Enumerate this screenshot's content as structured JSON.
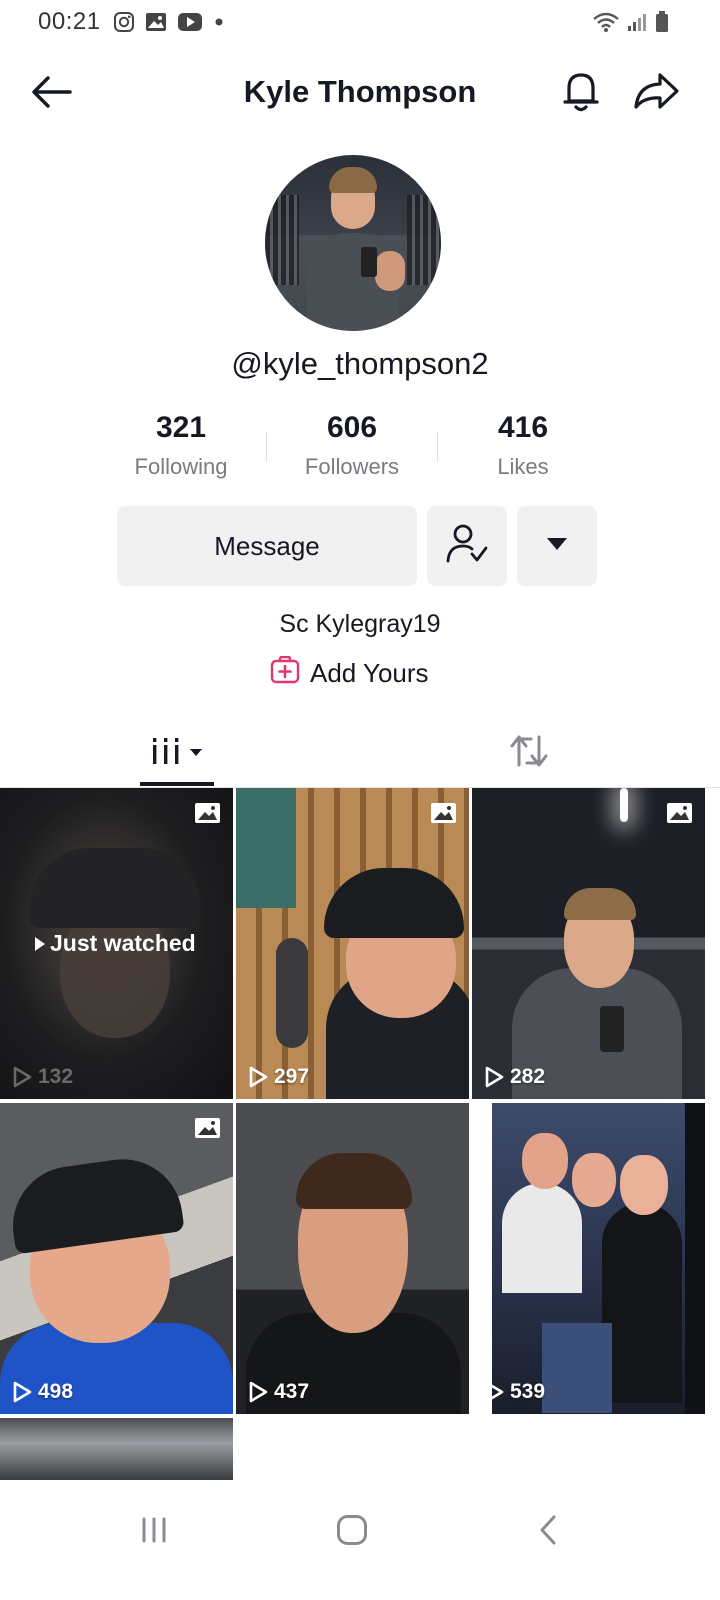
{
  "status_bar": {
    "time": "00:21",
    "left_icons": [
      "instagram-icon",
      "gallery-icon",
      "youtube-icon",
      "dot-icon"
    ],
    "right_icons": [
      "wifi-icon",
      "signal-icon",
      "battery-icon"
    ]
  },
  "header": {
    "title": "Kyle Thompson",
    "back_icon": "arrow-left-icon",
    "bell_icon": "bell-icon",
    "share_icon": "share-arrow-icon"
  },
  "profile": {
    "username": "@kyle_thompson2",
    "stats": [
      {
        "value": "321",
        "label": "Following"
      },
      {
        "value": "606",
        "label": "Followers"
      },
      {
        "value": "416",
        "label": "Likes"
      }
    ],
    "message_label": "Message",
    "bio": "Sc Kylegray19",
    "add_yours_label": "Add Yours"
  },
  "tabs": {
    "videos_icon": "grid-bars-icon",
    "reposts_icon": "repost-icon"
  },
  "grid": [
    {
      "views": "132",
      "photo": true,
      "just_watched": "Just watched",
      "dim": true
    },
    {
      "views": "297",
      "photo": true
    },
    {
      "views": "282",
      "photo": true
    },
    {
      "views": "498",
      "photo": true
    },
    {
      "views": "437",
      "photo": false
    },
    {
      "views": "539",
      "photo": false
    }
  ],
  "colors": {
    "accent": "#fe2c55",
    "text": "#161823",
    "secondary": "#7a7b80",
    "button_bg": "#f1f1f2"
  }
}
